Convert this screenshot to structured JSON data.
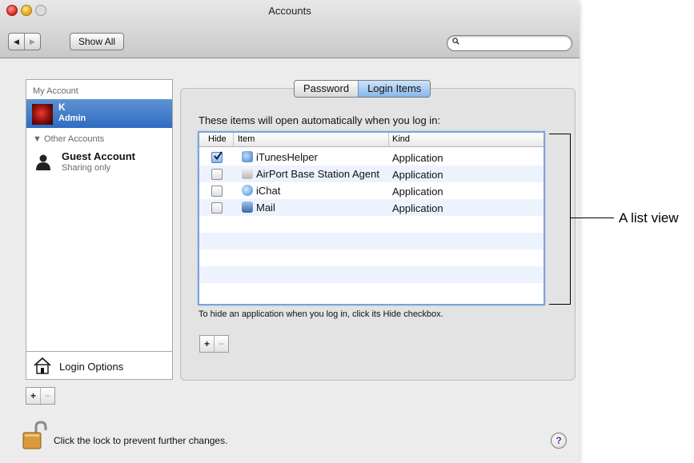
{
  "window": {
    "title": "Accounts"
  },
  "toolbar": {
    "back_label": "◀",
    "forward_label": "▶",
    "show_all_label": "Show All",
    "search_placeholder": ""
  },
  "sidebar": {
    "my_account_header": "My Account",
    "selected_account": {
      "name": "K",
      "role": "Admin"
    },
    "other_accounts_header": "▼ Other Accounts",
    "guest": {
      "name": "Guest Account",
      "subtitle": "Sharing only"
    },
    "login_options_label": "Login Options",
    "add_label": "+",
    "remove_label": "−"
  },
  "tabs": [
    {
      "label": "Password",
      "active": false
    },
    {
      "label": "Login Items",
      "active": true
    }
  ],
  "login_items": {
    "intro": "These items will open automatically when you log in:",
    "columns": {
      "hide": "Hide",
      "item": "Item",
      "kind": "Kind"
    },
    "rows": [
      {
        "hidden": true,
        "name": "iTunesHelper",
        "kind": "Application",
        "icon": "itunes-icon"
      },
      {
        "hidden": false,
        "name": "AirPort Base Station Agent",
        "kind": "Application",
        "icon": "airport-icon"
      },
      {
        "hidden": false,
        "name": "iChat",
        "kind": "Application",
        "icon": "ichat-icon"
      },
      {
        "hidden": false,
        "name": "Mail",
        "kind": "Application",
        "icon": "mail-icon"
      }
    ],
    "hint": "To hide an application when you log in, click its Hide checkbox.",
    "add_label": "+",
    "remove_label": "−"
  },
  "footer": {
    "lock_text": "Click the lock to prevent further changes.",
    "help_label": "?"
  },
  "annotation": {
    "label": "A list view"
  },
  "colors": {
    "selection": "#2f6bc2",
    "row_alt": "#edf3fe",
    "focus_ring": "#7ba4d6"
  }
}
